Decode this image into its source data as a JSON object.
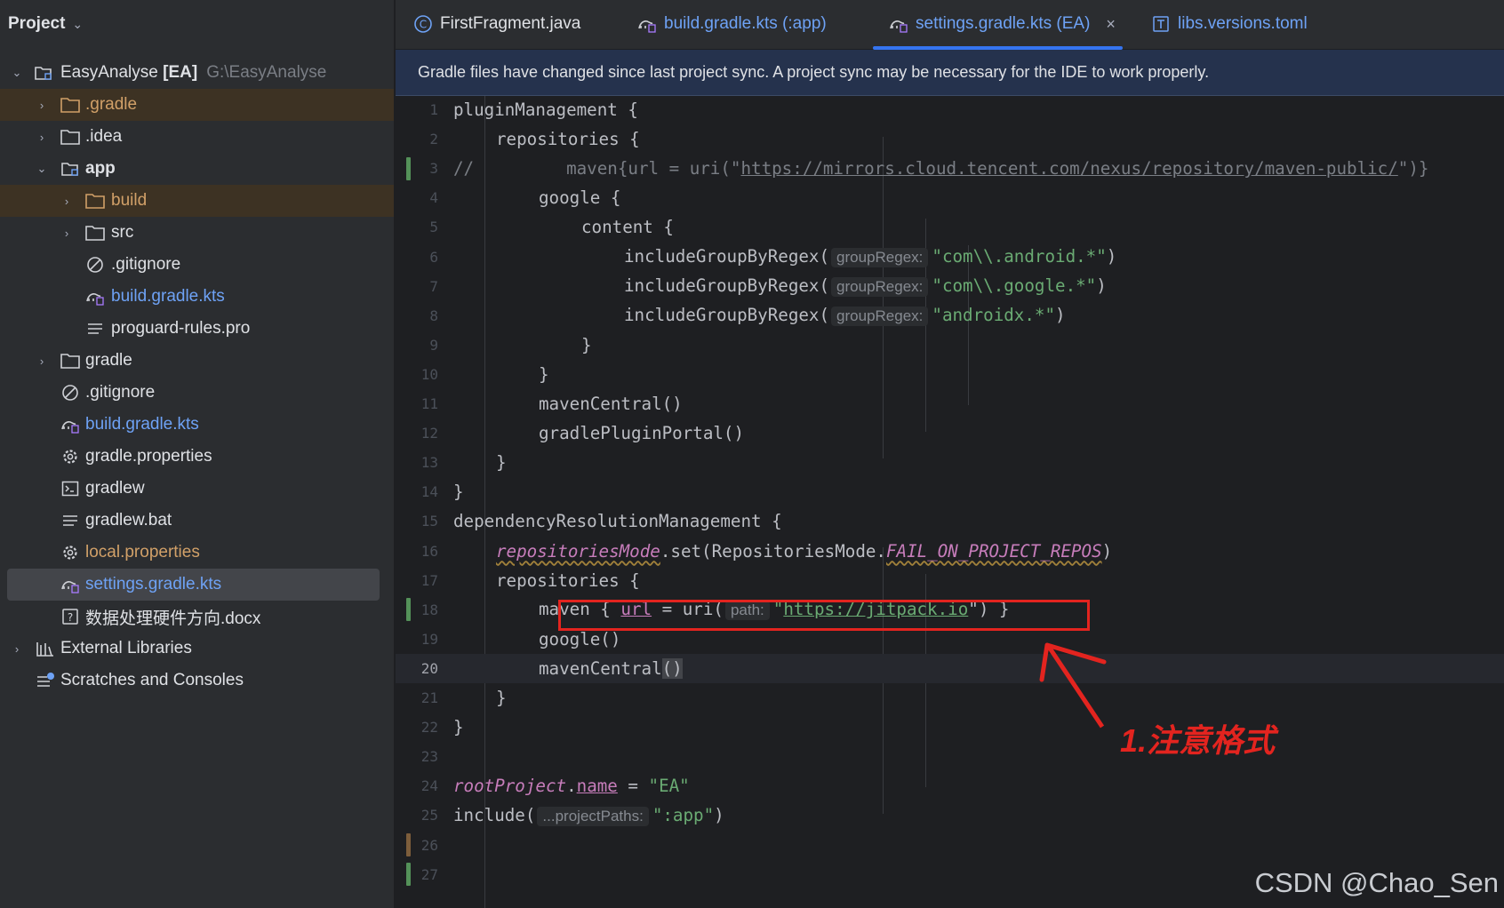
{
  "sidebar": {
    "title": "Project",
    "tree": [
      {
        "label": "EasyAnalyse",
        "bold_part": "[EA]",
        "path": "G:\\EasyAnalyse",
        "icon": "module-folder-icon",
        "expanded": true
      },
      {
        "label": ".gradle",
        "icon": "folder-icon",
        "style": "excluded"
      },
      {
        "label": ".idea",
        "icon": "folder-icon"
      },
      {
        "label": "app",
        "icon": "module-folder-icon",
        "expanded": true
      },
      {
        "label": "build",
        "icon": "folder-icon",
        "style": "excluded"
      },
      {
        "label": "src",
        "icon": "folder-icon"
      },
      {
        "label": ".gitignore",
        "icon": "ignore-file-icon"
      },
      {
        "label": "build.gradle.kts",
        "icon": "gradle-kts-icon",
        "style": "modified"
      },
      {
        "label": "proguard-rules.pro",
        "icon": "text-file-icon"
      },
      {
        "label": "gradle",
        "icon": "folder-icon"
      },
      {
        "label": ".gitignore",
        "icon": "ignore-file-icon"
      },
      {
        "label": "build.gradle.kts",
        "icon": "gradle-kts-icon",
        "style": "modified"
      },
      {
        "label": "gradle.properties",
        "icon": "settings-file-icon"
      },
      {
        "label": "gradlew",
        "icon": "terminal-file-icon"
      },
      {
        "label": "gradlew.bat",
        "icon": "text-file-icon"
      },
      {
        "label": "local.properties",
        "icon": "settings-file-icon",
        "style": "orange"
      },
      {
        "label": "settings.gradle.kts",
        "icon": "gradle-kts-icon",
        "style": "selected"
      },
      {
        "label": "数据处理硬件方向.docx",
        "icon": "unknown-file-icon"
      },
      {
        "label": "External Libraries",
        "icon": "library-icon"
      },
      {
        "label": "Scratches and Consoles",
        "icon": "scratches-icon"
      }
    ]
  },
  "tabs": [
    {
      "label": "FirstFragment.java",
      "icon": "java-class-icon"
    },
    {
      "label": "build.gradle.kts (:app)",
      "icon": "gradle-kts-icon"
    },
    {
      "label": "settings.gradle.kts (EA)",
      "icon": "gradle-kts-icon",
      "active": true
    },
    {
      "label": "libs.versions.toml",
      "icon": "toml-file-icon"
    }
  ],
  "tab_close_glyph": "×",
  "banner": "Gradle files have changed since last project sync. A project sync may be necessary for the IDE to work properly.",
  "editor": {
    "current_line": 20,
    "lines": [
      {
        "n": "1",
        "t": "pluginManagement {"
      },
      {
        "n": "2",
        "t": "repositories {"
      },
      {
        "n": "3",
        "pre": "//",
        "t": "maven{url = uri(\"",
        "u": "https://mirrors.cloud.tencent.com/nexus/repository/maven-public/",
        "post": "\")}"
      },
      {
        "n": "4",
        "t": "google {"
      },
      {
        "n": "5",
        "t": "content {"
      },
      {
        "n": "6",
        "t": "includeGroupByRegex(",
        "hint": "groupRegex:",
        "s": "\"com\\\\.android.*\"",
        "post": ")"
      },
      {
        "n": "7",
        "t": "includeGroupByRegex(",
        "hint": "groupRegex:",
        "s": "\"com\\\\.google.*\"",
        "post": ")"
      },
      {
        "n": "8",
        "t": "includeGroupByRegex(",
        "hint": "groupRegex:",
        "s": "\"androidx.*\"",
        "post": ")"
      },
      {
        "n": "9",
        "t": "}"
      },
      {
        "n": "10",
        "t": "}"
      },
      {
        "n": "11",
        "t": "mavenCentral()"
      },
      {
        "n": "12",
        "t": "gradlePluginPortal()"
      },
      {
        "n": "13",
        "t": "}"
      },
      {
        "n": "14",
        "t": "}"
      },
      {
        "n": "15",
        "t": "dependencyResolutionManagement {"
      },
      {
        "n": "16",
        "p": "repositoriesMode",
        "t": ".set(RepositoriesMode.",
        "p2": "FAIL_ON_PROJECT_REPOS",
        "post": ")"
      },
      {
        "n": "17",
        "t": "repositories {"
      },
      {
        "n": "18",
        "t": "maven { ",
        "p": "url",
        "t2": " = uri(",
        "hint": "path:",
        "u": "https://jitpack.io",
        "post": "\") }"
      },
      {
        "n": "19",
        "t": "google()"
      },
      {
        "n": "20",
        "t": "mavenCentral",
        "post": "()"
      },
      {
        "n": "21",
        "t": "}"
      },
      {
        "n": "22",
        "t": "}"
      },
      {
        "n": "23",
        "t": ""
      },
      {
        "n": "24",
        "p": "rootProject",
        "t": ".",
        "p2": "name",
        "t2": " = ",
        "s": "\"EA\""
      },
      {
        "n": "25",
        "t": "include(",
        "hint": "...projectPaths:",
        "s": "\":app\"",
        "post": ")"
      },
      {
        "n": "26",
        "t": ""
      },
      {
        "n": "27",
        "t": ""
      }
    ]
  },
  "annotation": "1.注意格式",
  "watermark": "CSDN @Chao_Sen",
  "colors": {
    "accent": "#3574f0",
    "annotation_red": "#e3241f",
    "string_green": "#6aab73",
    "property_purple": "#c77dbb",
    "excluded_orange": "#d1a068",
    "link_blue": "#6ea2f5"
  }
}
